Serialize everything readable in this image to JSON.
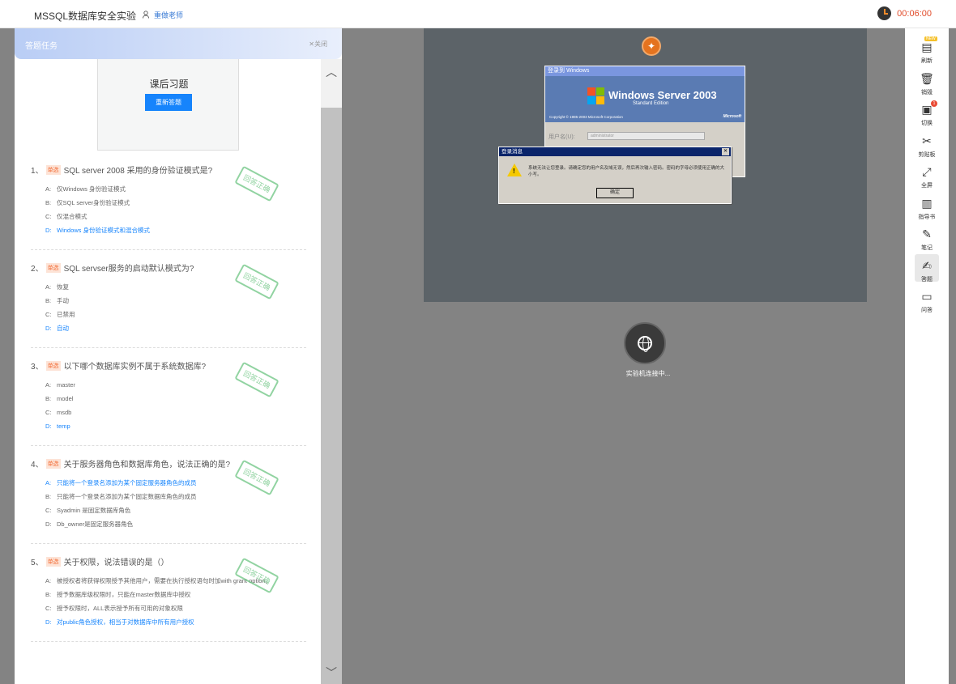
{
  "header": {
    "title": "MSSQL数据库安全实验",
    "teacher": "重做老师",
    "timer": "00:06:00"
  },
  "panel": {
    "title": "答题任务",
    "close": "✕关闭",
    "exercise_title": "课后习题",
    "redo_button": "重新答题"
  },
  "stamp_text": "回答正确",
  "questions": [
    {
      "num": "1、",
      "tag": "单选",
      "text": "SQL server 2008 采用的身份验证模式是?",
      "options": [
        {
          "letter": "A:",
          "text": "仅Windows 身份验证模式"
        },
        {
          "letter": "B:",
          "text": "仅SQL server身份验证模式"
        },
        {
          "letter": "C:",
          "text": "仅混合模式"
        },
        {
          "letter": "D:",
          "text": "Windows 身份验证模式和混合模式"
        }
      ],
      "selected": 3
    },
    {
      "num": "2、",
      "tag": "单选",
      "text": "SQL servser服务的启动默认模式为?",
      "options": [
        {
          "letter": "A:",
          "text": "恢复"
        },
        {
          "letter": "B:",
          "text": "手动"
        },
        {
          "letter": "C:",
          "text": "已禁用"
        },
        {
          "letter": "D:",
          "text": "自动"
        }
      ],
      "selected": 3
    },
    {
      "num": "3、",
      "tag": "单选",
      "text": "以下哪个数据库实例不属于系统数据库?",
      "options": [
        {
          "letter": "A:",
          "text": "master"
        },
        {
          "letter": "B:",
          "text": "model"
        },
        {
          "letter": "C:",
          "text": "msdb"
        },
        {
          "letter": "D:",
          "text": "temp"
        }
      ],
      "selected": 3
    },
    {
      "num": "4、",
      "tag": "单选",
      "text": "关于服务器角色和数据库角色，说法正确的是?",
      "options": [
        {
          "letter": "A:",
          "text": "只能将一个登录名添加为某个固定服务器角色的成员"
        },
        {
          "letter": "B:",
          "text": "只能将一个登录名添加为某个固定数据库角色的成员"
        },
        {
          "letter": "C:",
          "text": "Syadmin 是固定数据库角色"
        },
        {
          "letter": "D:",
          "text": "Db_owner是固定服务器角色"
        }
      ],
      "selected": 0
    },
    {
      "num": "5、",
      "tag": "单选",
      "text": "关于权限，说法错误的是（）",
      "options": [
        {
          "letter": "A:",
          "text": "被授权者将获得权限授予其他用户，需要在执行授权语句时加with grant option。"
        },
        {
          "letter": "B:",
          "text": "授予数据库级权限时，只能在master数据库中授权"
        },
        {
          "letter": "C:",
          "text": "授予权限时，ALL表示授予所有可用的对象权限"
        },
        {
          "letter": "D:",
          "text": "对public角色授权，相当于对数据库中所有用户授权"
        }
      ],
      "selected": 3
    }
  ],
  "vm": {
    "login_title": "登录到 Windows",
    "brand": "Windows Server 2003",
    "edition": "Standard Edition",
    "copyright": "Copyright © 1985-2003  Microsoft Corporation",
    "ms": "Microsoft",
    "user_label": "用户名(U):",
    "user_value": "administrator",
    "msg_title": "登录消息",
    "msg_text": "系统无法让您登录。请确定您的用户名及域无误，然后再次输入密码。密码的字母必须使用正确的大小写。",
    "ok": "确定"
  },
  "connect_label": "实验机连接中...",
  "toolbar": [
    {
      "label": "刷新",
      "icon": "refresh-icon",
      "glyph": "▤",
      "badge": "NEW"
    },
    {
      "label": "销毁",
      "icon": "trash-icon",
      "glyph": "🗑"
    },
    {
      "label": "切换",
      "icon": "switch-icon",
      "glyph": "▣",
      "badge": "1"
    },
    {
      "label": "剪贴板",
      "icon": "scissors-icon",
      "glyph": "✂"
    },
    {
      "label": "全屏",
      "icon": "fullscreen-icon",
      "glyph": "⤢"
    },
    {
      "label": "指导书",
      "icon": "book-icon",
      "glyph": "▥"
    },
    {
      "label": "笔记",
      "icon": "pen-icon",
      "glyph": "✎"
    },
    {
      "label": "答题",
      "icon": "answer-icon",
      "glyph": "✍",
      "active": true
    },
    {
      "label": "问答",
      "icon": "chat-icon",
      "glyph": "▭"
    }
  ]
}
